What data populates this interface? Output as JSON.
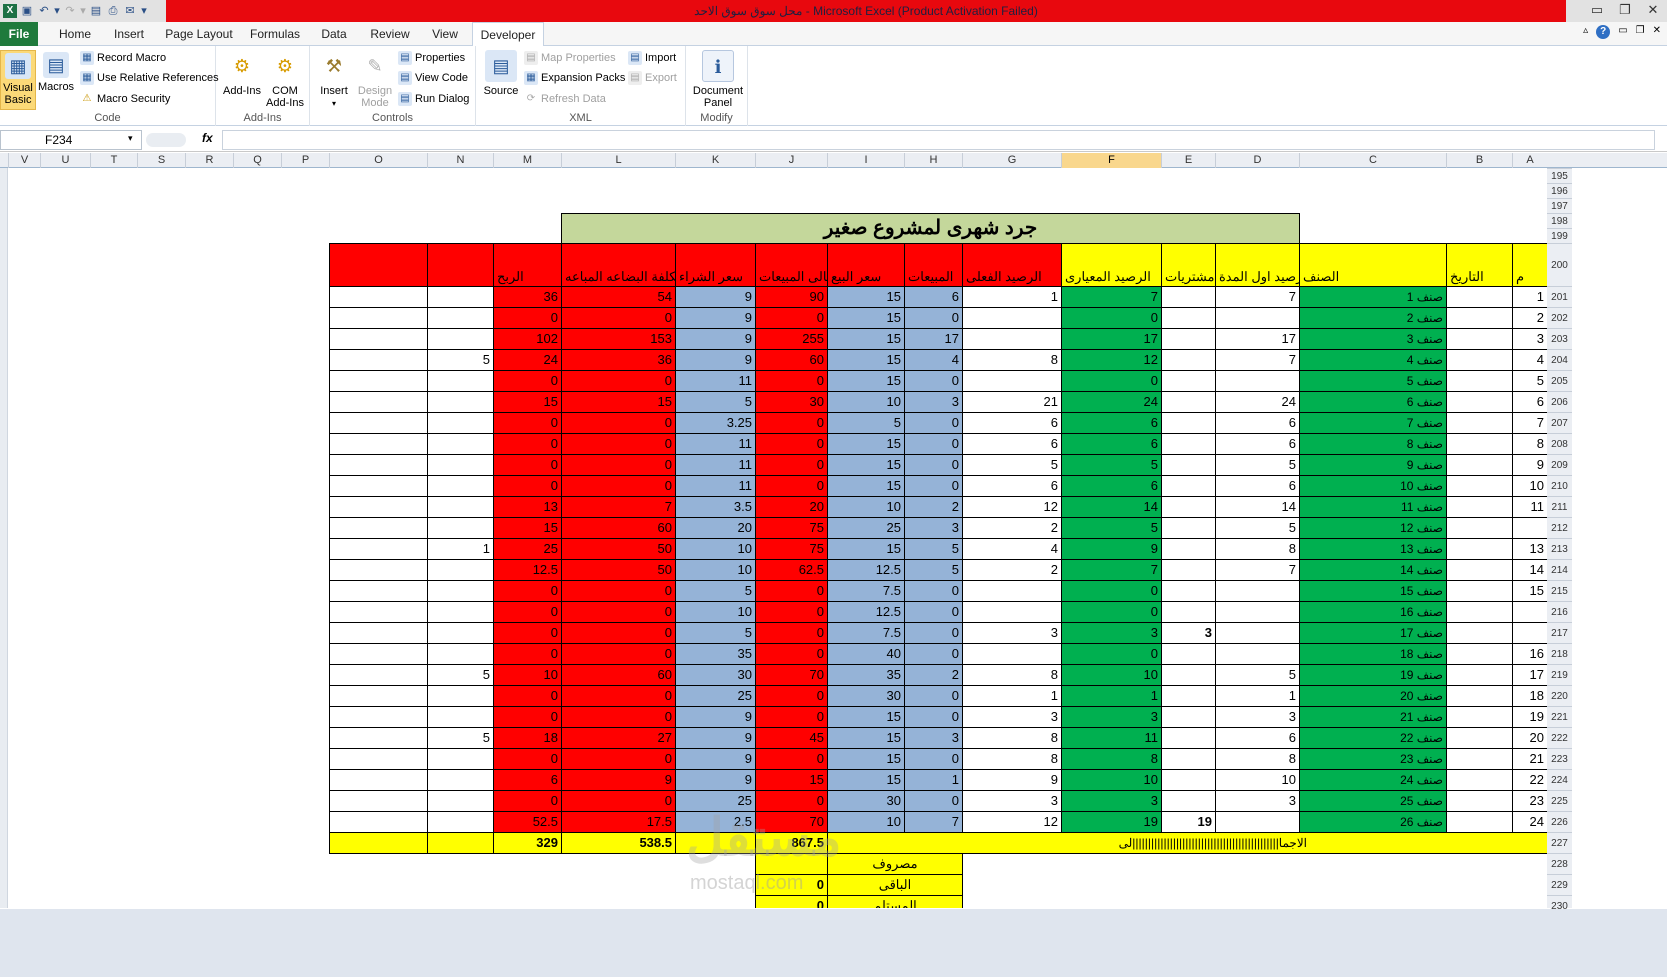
{
  "window": {
    "title": "محل سوق سوق الاحد  -  Microsoft Excel (Product Activation Failed)"
  },
  "tabs": [
    "File",
    "Home",
    "Insert",
    "Page Layout",
    "Formulas",
    "Data",
    "Review",
    "View",
    "Developer"
  ],
  "ribbon": {
    "code": {
      "label": "Code",
      "visual_basic": "Visual Basic",
      "macros": "Macros",
      "record_macro": "Record Macro",
      "relative_refs": "Use Relative References",
      "macro_security": "Macro Security"
    },
    "addins": {
      "label": "Add-Ins",
      "addins": "Add-Ins",
      "com_addins": "COM Add-Ins"
    },
    "controls": {
      "label": "Controls",
      "insert": "Insert",
      "design_mode": "Design Mode",
      "properties": "Properties",
      "view_code": "View Code",
      "run_dialog": "Run Dialog"
    },
    "xml": {
      "label": "XML",
      "source": "Source",
      "map_properties": "Map Properties",
      "expansion_packs": "Expansion Packs",
      "refresh_data": "Refresh Data",
      "import": "Import",
      "export": "Export"
    },
    "modify": {
      "label": "Modify",
      "document_panel": "Document Panel"
    }
  },
  "formula_bar": {
    "name_box": "F234",
    "fx": "fx",
    "value": ""
  },
  "columns": [
    "V",
    "U",
    "T",
    "S",
    "R",
    "Q",
    "P",
    "O",
    "N",
    "M",
    "L",
    "K",
    "J",
    "I",
    "H",
    "G",
    "F",
    "E",
    "D",
    "C",
    "B",
    "A"
  ],
  "rows": [
    "195",
    "196",
    "197",
    "198",
    "199",
    "200",
    "201",
    "202",
    "203",
    "204",
    "205",
    "206",
    "207",
    "208",
    "209",
    "210",
    "211",
    "212",
    "213",
    "214",
    "215",
    "216",
    "217",
    "218",
    "219",
    "220",
    "221",
    "222",
    "223",
    "224",
    "225",
    "226",
    "227",
    "228",
    "229",
    "230"
  ],
  "sheet": {
    "title": "جرد شهرى لمشروع صغير",
    "headers": {
      "m": "م",
      "date": "التاريخ",
      "item": "الصنف",
      "opening": "رصيد اول المدة",
      "purchases": "مشتريات",
      "standard_bal": "الرصيد المعيارى",
      "actual_bal": "الرصيد الفعلى",
      "sales": "المبيعات",
      "sell_price": "سعر البيع",
      "total_sales": "اجمالى المبيعات",
      "buy_price": "سعر الشراء",
      "cost": "تكلفة البضاعه المباعه",
      "profit": "الربح"
    },
    "rows": [
      {
        "m": "1",
        "item": "صنف 1",
        "d": "7",
        "e": "",
        "f": "7",
        "g": "1",
        "h": "6",
        "i": "15",
        "j": "90",
        "k": "9",
        "l": "54",
        "mm": "36",
        "n": ""
      },
      {
        "m": "2",
        "item": "صنف 2",
        "d": "",
        "e": "",
        "f": "0",
        "g": "",
        "h": "0",
        "i": "15",
        "j": "0",
        "k": "9",
        "l": "0",
        "mm": "0",
        "n": ""
      },
      {
        "m": "3",
        "item": "صنف 3",
        "d": "17",
        "e": "",
        "f": "17",
        "g": "",
        "h": "17",
        "i": "15",
        "j": "255",
        "k": "9",
        "l": "153",
        "mm": "102",
        "n": ""
      },
      {
        "m": "4",
        "item": "صنف 4",
        "d": "7",
        "e": "",
        "f": "12",
        "g": "8",
        "h": "4",
        "i": "15",
        "j": "60",
        "k": "9",
        "l": "36",
        "mm": "24",
        "n": "5"
      },
      {
        "m": "5",
        "item": "صنف 5",
        "d": "",
        "e": "",
        "f": "0",
        "g": "",
        "h": "0",
        "i": "15",
        "j": "0",
        "k": "11",
        "l": "0",
        "mm": "0",
        "n": ""
      },
      {
        "m": "6",
        "item": "صنف 6",
        "d": "24",
        "e": "",
        "f": "24",
        "g": "21",
        "h": "3",
        "i": "10",
        "j": "30",
        "k": "5",
        "l": "15",
        "mm": "15",
        "n": ""
      },
      {
        "m": "7",
        "item": "صنف 7",
        "d": "6",
        "e": "",
        "f": "6",
        "g": "6",
        "h": "0",
        "i": "5",
        "j": "0",
        "k": "3.25",
        "l": "0",
        "mm": "0",
        "n": ""
      },
      {
        "m": "8",
        "item": "صنف 8",
        "d": "6",
        "e": "",
        "f": "6",
        "g": "6",
        "h": "0",
        "i": "15",
        "j": "0",
        "k": "11",
        "l": "0",
        "mm": "0",
        "n": ""
      },
      {
        "m": "9",
        "item": "صنف 9",
        "d": "5",
        "e": "",
        "f": "5",
        "g": "5",
        "h": "0",
        "i": "15",
        "j": "0",
        "k": "11",
        "l": "0",
        "mm": "0",
        "n": ""
      },
      {
        "m": "10",
        "item": "صنف 10",
        "d": "6",
        "e": "",
        "f": "6",
        "g": "6",
        "h": "0",
        "i": "15",
        "j": "0",
        "k": "11",
        "l": "0",
        "mm": "0",
        "n": ""
      },
      {
        "m": "11",
        "item": "صنف 11",
        "d": "14",
        "e": "",
        "f": "14",
        "g": "12",
        "h": "2",
        "i": "10",
        "j": "20",
        "k": "3.5",
        "l": "7",
        "mm": "13",
        "n": ""
      },
      {
        "m": "",
        "item": "صنف 12",
        "d": "5",
        "e": "",
        "f": "5",
        "g": "2",
        "h": "3",
        "i": "25",
        "j": "75",
        "k": "20",
        "l": "60",
        "mm": "15",
        "n": ""
      },
      {
        "m": "13",
        "item": "صنف 13",
        "d": "8",
        "e": "",
        "f": "9",
        "g": "4",
        "h": "5",
        "i": "15",
        "j": "75",
        "k": "10",
        "l": "50",
        "mm": "25",
        "n": "1"
      },
      {
        "m": "14",
        "item": "صنف 14",
        "d": "7",
        "e": "",
        "f": "7",
        "g": "2",
        "h": "5",
        "i": "12.5",
        "j": "62.5",
        "k": "10",
        "l": "50",
        "mm": "12.5",
        "n": ""
      },
      {
        "m": "15",
        "item": "صنف 15",
        "d": "",
        "e": "",
        "f": "0",
        "g": "",
        "h": "0",
        "i": "7.5",
        "j": "0",
        "k": "5",
        "l": "0",
        "mm": "0",
        "n": ""
      },
      {
        "m": "",
        "item": "صنف 16",
        "d": "",
        "e": "",
        "f": "0",
        "g": "",
        "h": "0",
        "i": "12.5",
        "j": "0",
        "k": "10",
        "l": "0",
        "mm": "0",
        "n": ""
      },
      {
        "m": "",
        "item": "صنف 17",
        "d": "",
        "e": "3",
        "f": "3",
        "g": "3",
        "h": "0",
        "i": "7.5",
        "j": "0",
        "k": "5",
        "l": "0",
        "mm": "0",
        "n": ""
      },
      {
        "m": "16",
        "item": "صنف 18",
        "d": "",
        "e": "",
        "f": "0",
        "g": "",
        "h": "0",
        "i": "40",
        "j": "0",
        "k": "35",
        "l": "0",
        "mm": "0",
        "n": ""
      },
      {
        "m": "17",
        "item": "صنف 19",
        "d": "5",
        "e": "",
        "f": "10",
        "g": "8",
        "h": "2",
        "i": "35",
        "j": "70",
        "k": "30",
        "l": "60",
        "mm": "10",
        "n": "5"
      },
      {
        "m": "18",
        "item": "صنف 20",
        "d": "1",
        "e": "",
        "f": "1",
        "g": "1",
        "h": "0",
        "i": "30",
        "j": "0",
        "k": "25",
        "l": "0",
        "mm": "0",
        "n": ""
      },
      {
        "m": "19",
        "item": "صنف 21",
        "d": "3",
        "e": "",
        "f": "3",
        "g": "3",
        "h": "0",
        "i": "15",
        "j": "0",
        "k": "9",
        "l": "0",
        "mm": "0",
        "n": ""
      },
      {
        "m": "20",
        "item": "صنف 22",
        "d": "6",
        "e": "",
        "f": "11",
        "g": "8",
        "h": "3",
        "i": "15",
        "j": "45",
        "k": "9",
        "l": "27",
        "mm": "18",
        "n": "5"
      },
      {
        "m": "21",
        "item": "صنف 23",
        "d": "8",
        "e": "",
        "f": "8",
        "g": "8",
        "h": "0",
        "i": "15",
        "j": "0",
        "k": "9",
        "l": "0",
        "mm": "0",
        "n": ""
      },
      {
        "m": "22",
        "item": "صنف 24",
        "d": "10",
        "e": "",
        "f": "10",
        "g": "9",
        "h": "1",
        "i": "15",
        "j": "15",
        "k": "9",
        "l": "9",
        "mm": "6",
        "n": ""
      },
      {
        "m": "23",
        "item": "صنف 25",
        "d": "3",
        "e": "",
        "f": "3",
        "g": "3",
        "h": "0",
        "i": "30",
        "j": "0",
        "k": "25",
        "l": "0",
        "mm": "0",
        "n": ""
      },
      {
        "m": "24",
        "item": "صنف 26",
        "d": "",
        "e": "19",
        "f": "19",
        "g": "12",
        "h": "7",
        "i": "10",
        "j": "70",
        "k": "2.5",
        "l": "17.5",
        "mm": "52.5",
        "n": ""
      }
    ],
    "totals": {
      "label": "الاجما|||||||||||||||||||||||||||||||||||||||||||||||لى",
      "total_sales": "867.5",
      "cost": "538.5",
      "profit": "329"
    },
    "summary": [
      {
        "label": "مصروف",
        "value": ""
      },
      {
        "label": "الباقى",
        "value": "0"
      },
      {
        "label": "المستلم",
        "value": "0"
      }
    ]
  },
  "watermark": {
    "arabic": "مستقل",
    "latin": "mostaql.com"
  }
}
